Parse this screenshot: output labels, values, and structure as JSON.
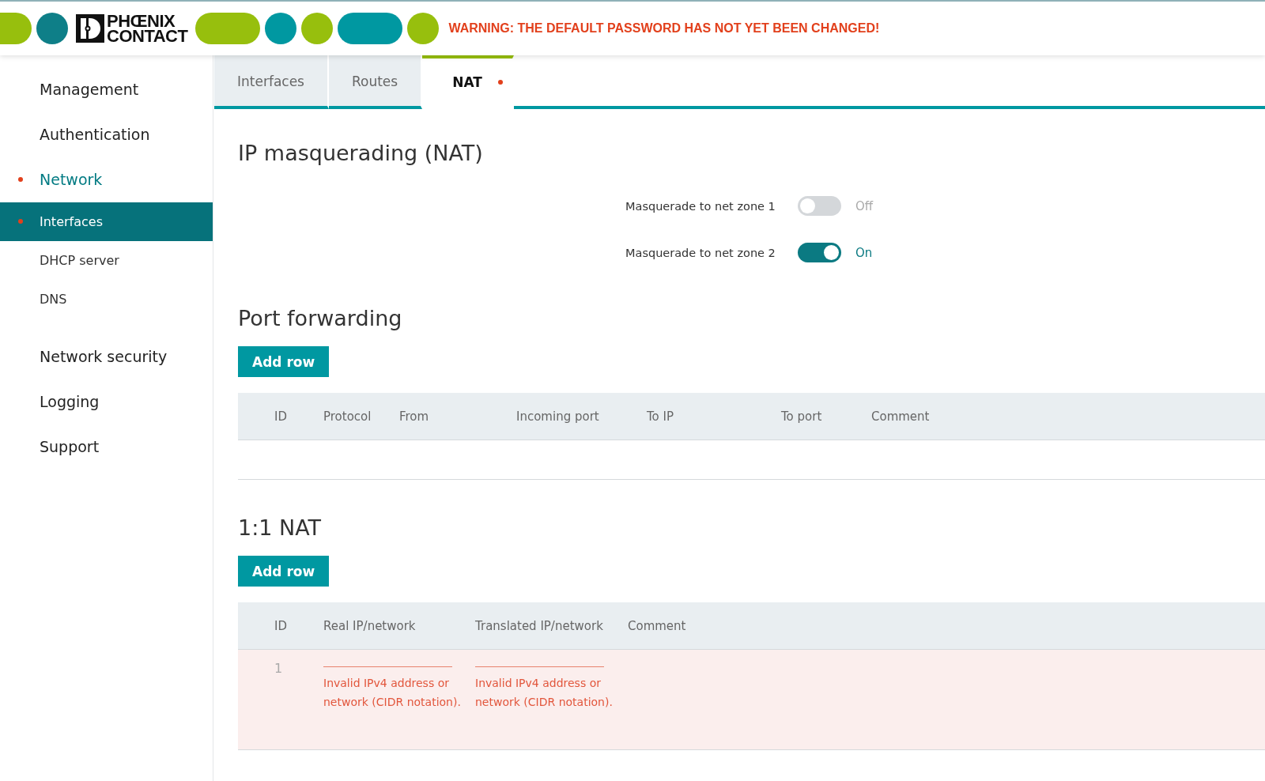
{
  "header": {
    "logo": [
      "PHŒNIX",
      "CONTACT"
    ],
    "warning": "WARNING: THE DEFAULT PASSWORD HAS NOT YET BEEN CHANGED!"
  },
  "sidebar": {
    "items": [
      {
        "kind": "section",
        "label": "Management",
        "selected": false,
        "flagged": false
      },
      {
        "kind": "section",
        "label": "Authentication",
        "selected": false,
        "flagged": false
      },
      {
        "kind": "section",
        "label": "Network",
        "selected": true,
        "flagged": true,
        "children": [
          {
            "label": "Interfaces",
            "selected": true,
            "flagged": true
          },
          {
            "label": "DHCP server",
            "selected": false,
            "flagged": false
          },
          {
            "label": "DNS",
            "selected": false,
            "flagged": false
          }
        ]
      },
      {
        "kind": "section",
        "label": "Network security",
        "selected": false,
        "flagged": false
      },
      {
        "kind": "section",
        "label": "Logging",
        "selected": false,
        "flagged": false
      },
      {
        "kind": "section",
        "label": "Support",
        "selected": false,
        "flagged": false
      }
    ]
  },
  "tabs": [
    {
      "label": "Interfaces",
      "selected": false,
      "flagged": false
    },
    {
      "label": "Routes",
      "selected": false,
      "flagged": false
    },
    {
      "label": "NAT",
      "selected": true,
      "flagged": true
    }
  ],
  "masquerading": {
    "title": "IP masquerading (NAT)",
    "toggles": [
      {
        "label": "Masquerade to net zone 1",
        "on": false,
        "state_text": "Off"
      },
      {
        "label": "Masquerade to net zone 2",
        "on": true,
        "state_text": "On"
      }
    ]
  },
  "port_forwarding": {
    "title": "Port forwarding",
    "button": "Add row",
    "columns": [
      "ID",
      "Protocol",
      "From",
      "Incoming port",
      "To IP",
      "To port",
      "Comment"
    ]
  },
  "one_to_one_nat": {
    "title": "1:1 NAT",
    "button": "Add row",
    "columns": [
      "ID",
      "Real IP/network",
      "Translated IP/network",
      "Comment"
    ],
    "rows": [
      {
        "id": "1",
        "invalid": true,
        "real_error": "Invalid IPv4 address or network (CIDR notation).",
        "translated_error": "Invalid IPv4 address or network (CIDR notation)."
      }
    ]
  }
}
